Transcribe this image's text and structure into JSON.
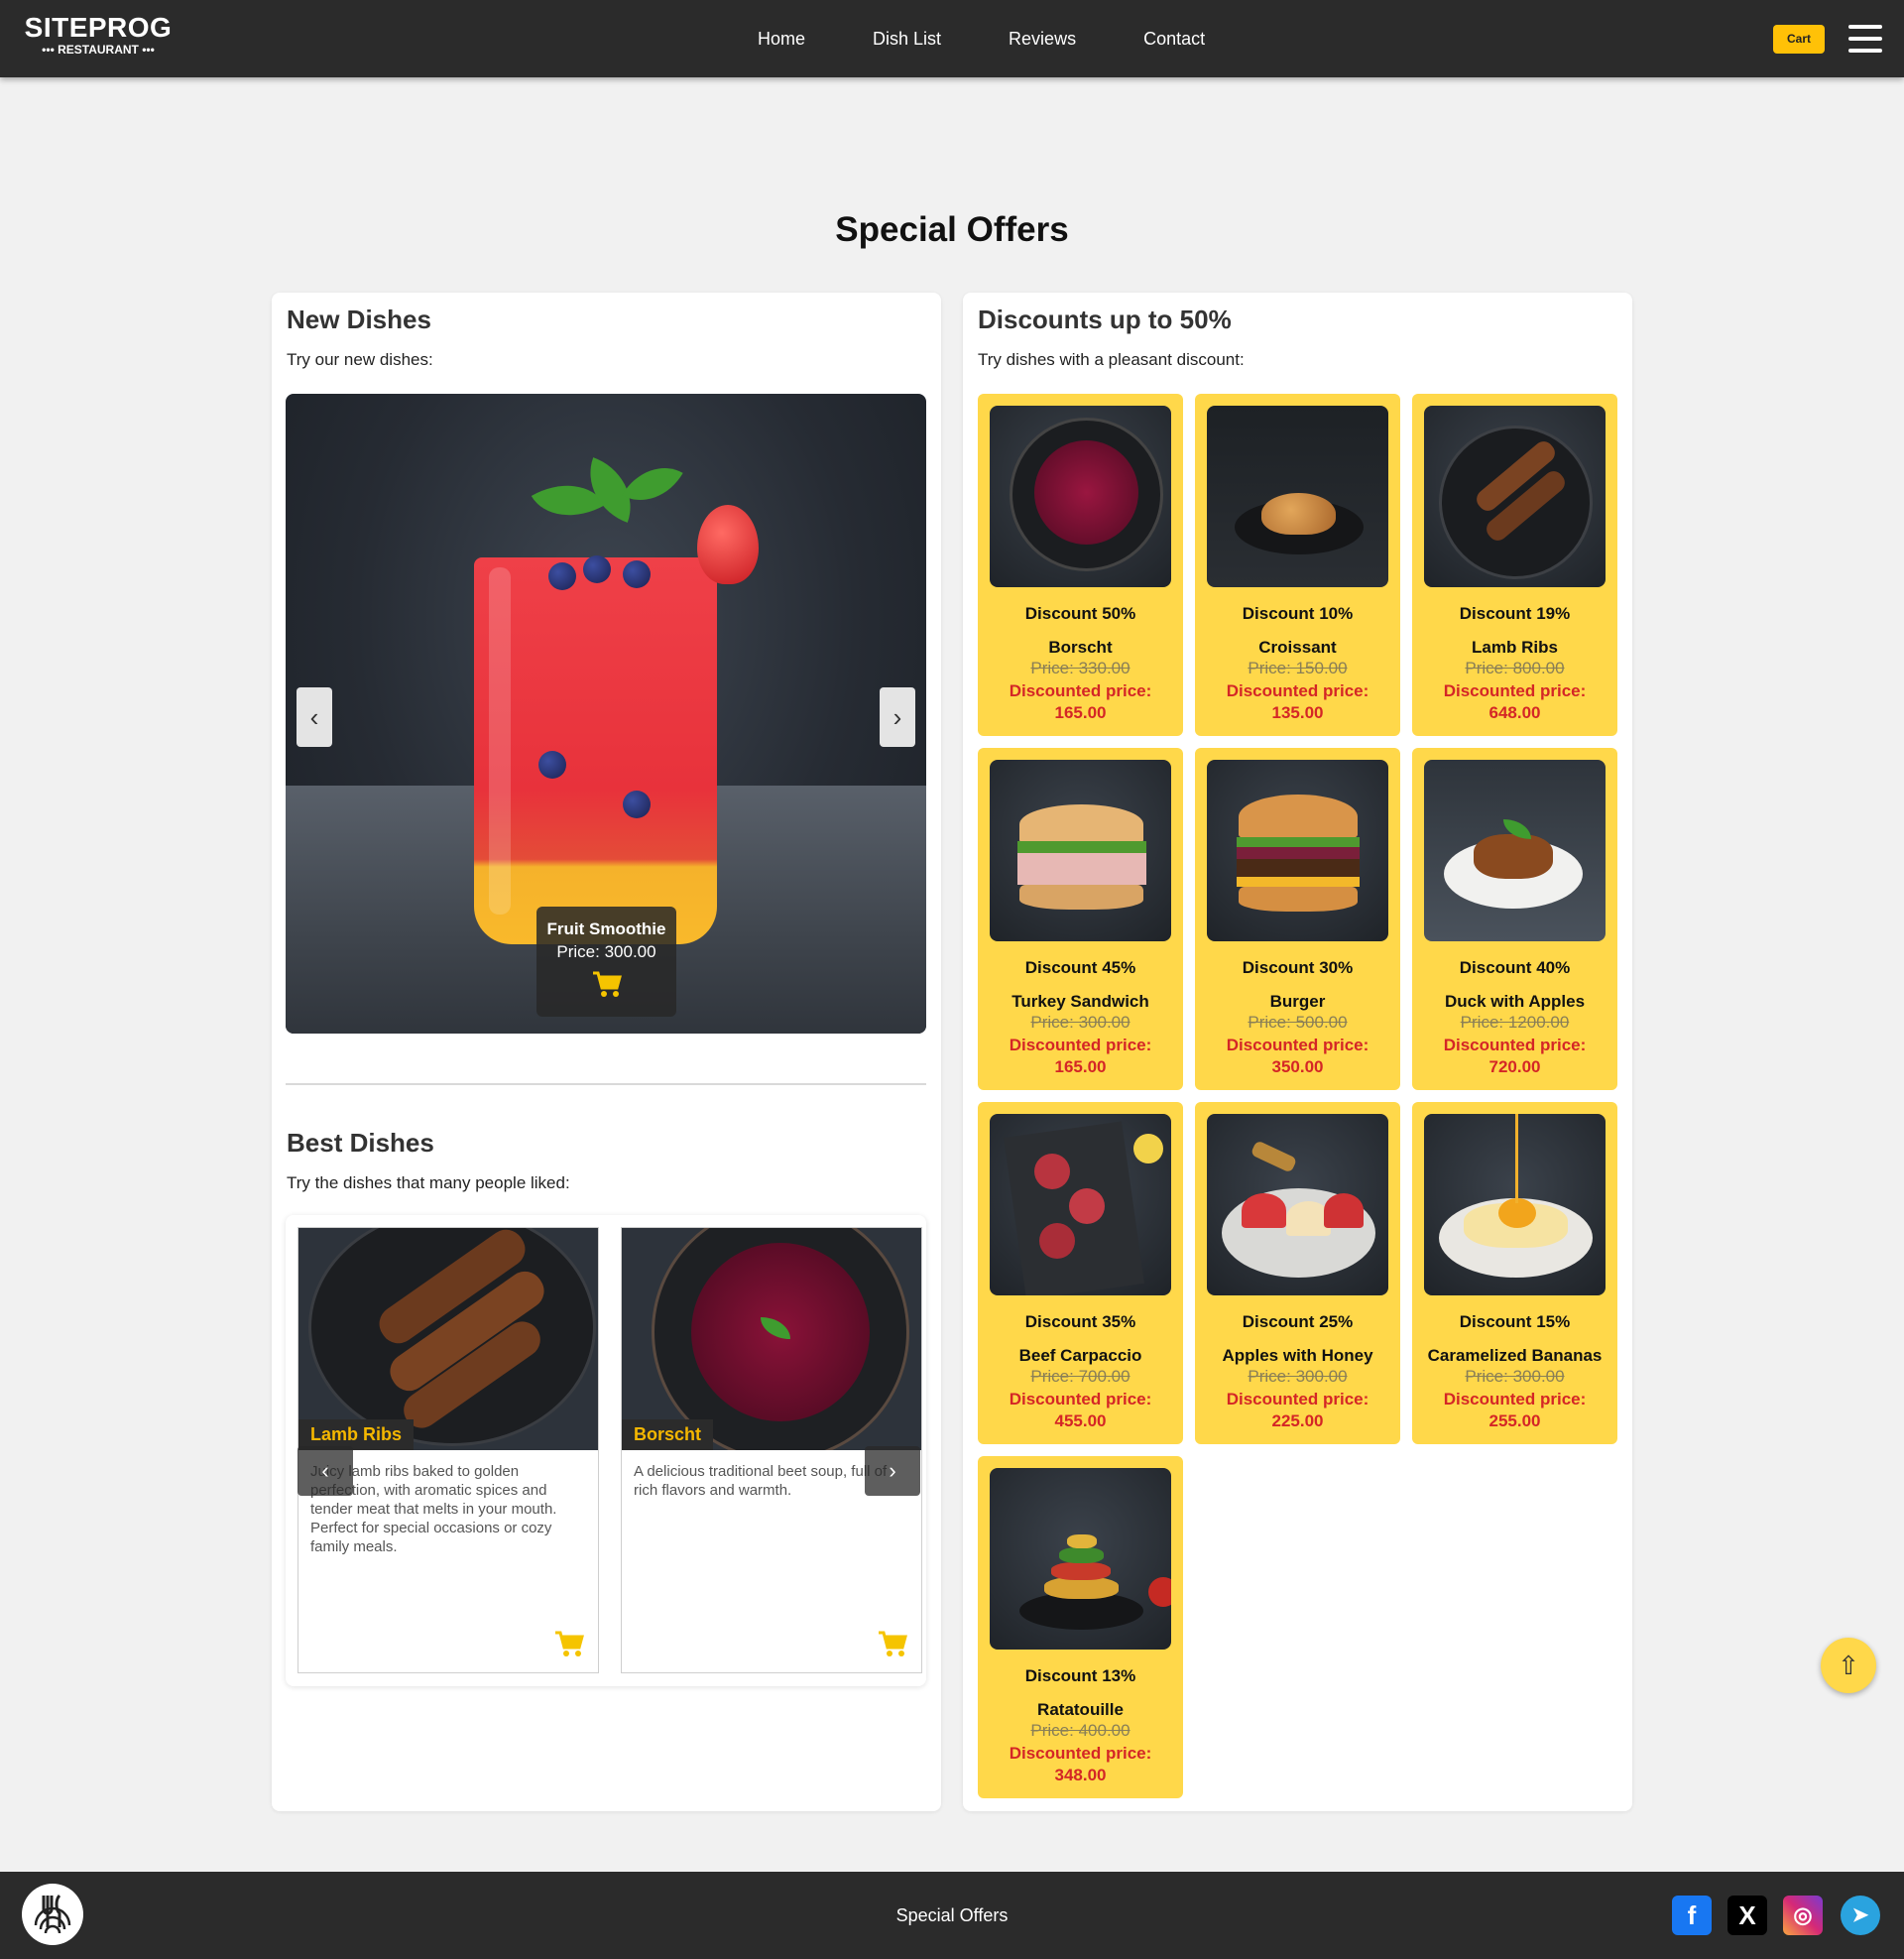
{
  "header": {
    "logo_main": "SITEPROG",
    "logo_sub": "••• RESTAURANT •••",
    "nav": [
      "Home",
      "Dish List",
      "Reviews",
      "Contact"
    ],
    "cart_label": "Cart",
    "menu_icon": "hamburger-icon"
  },
  "page_title": "Special Offers",
  "new_dishes": {
    "title": "New Dishes",
    "subtitle": "Try our new dishes:",
    "slide": {
      "name": "Fruit Smoothie",
      "price": "Price: 300.00"
    },
    "prev": "‹",
    "next": "›"
  },
  "best_dishes": {
    "title": "Best Dishes",
    "subtitle": "Try the dishes that many people liked:",
    "cards": [
      {
        "name": "Lamb Ribs",
        "desc": "Juicy lamb ribs baked to golden perfection, with aromatic spices and tender meat that melts in your mouth. Perfect for special occasions or cozy family meals."
      },
      {
        "name": "Borscht",
        "desc": "A delicious traditional beet soup, full of rich flavors and warmth."
      }
    ],
    "prev": "‹",
    "next": "›"
  },
  "discounts": {
    "title": "Discounts up to 50%",
    "subtitle": "Try dishes with a pleasant discount:",
    "discounted_label": "Discounted price:",
    "items": [
      {
        "discount": "Discount 50%",
        "name": "Borscht",
        "old": "Price: 330.00",
        "new": "165.00"
      },
      {
        "discount": "Discount 10%",
        "name": "Croissant",
        "old": "Price: 150.00",
        "new": "135.00"
      },
      {
        "discount": "Discount 19%",
        "name": "Lamb Ribs",
        "old": "Price: 800.00",
        "new": "648.00"
      },
      {
        "discount": "Discount 45%",
        "name": "Turkey Sandwich",
        "old": "Price: 300.00",
        "new": "165.00"
      },
      {
        "discount": "Discount 30%",
        "name": "Burger",
        "old": "Price: 500.00",
        "new": "350.00"
      },
      {
        "discount": "Discount 40%",
        "name": "Duck with Apples",
        "old": "Price: 1200.00",
        "new": "720.00"
      },
      {
        "discount": "Discount 35%",
        "name": "Beef Carpaccio",
        "old": "Price: 700.00",
        "new": "455.00"
      },
      {
        "discount": "Discount 25%",
        "name": "Apples with Honey",
        "old": "Price: 300.00",
        "new": "225.00"
      },
      {
        "discount": "Discount 15%",
        "name": "Caramelized Bananas",
        "old": "Price: 300.00",
        "new": "255.00"
      },
      {
        "discount": "Discount 13%",
        "name": "Ratatouille",
        "old": "Price: 400.00",
        "new": "348.00"
      }
    ]
  },
  "scroll_top": "⇧",
  "footer": {
    "text": "Special Offers",
    "social": [
      {
        "icon": "facebook-icon",
        "glyph": "f",
        "color": "#1877f2"
      },
      {
        "icon": "x-icon",
        "glyph": "X",
        "color": "#000000"
      },
      {
        "icon": "instagram-icon",
        "glyph": "◎",
        "color": "#c13584"
      },
      {
        "icon": "telegram-icon",
        "glyph": "➤",
        "color": "#2aa3df"
      }
    ]
  },
  "colors": {
    "accent": "#ffd84a",
    "cart_yellow": "#ffc107",
    "header_bg": "#2b2b2b",
    "discount_red": "#d42626"
  }
}
